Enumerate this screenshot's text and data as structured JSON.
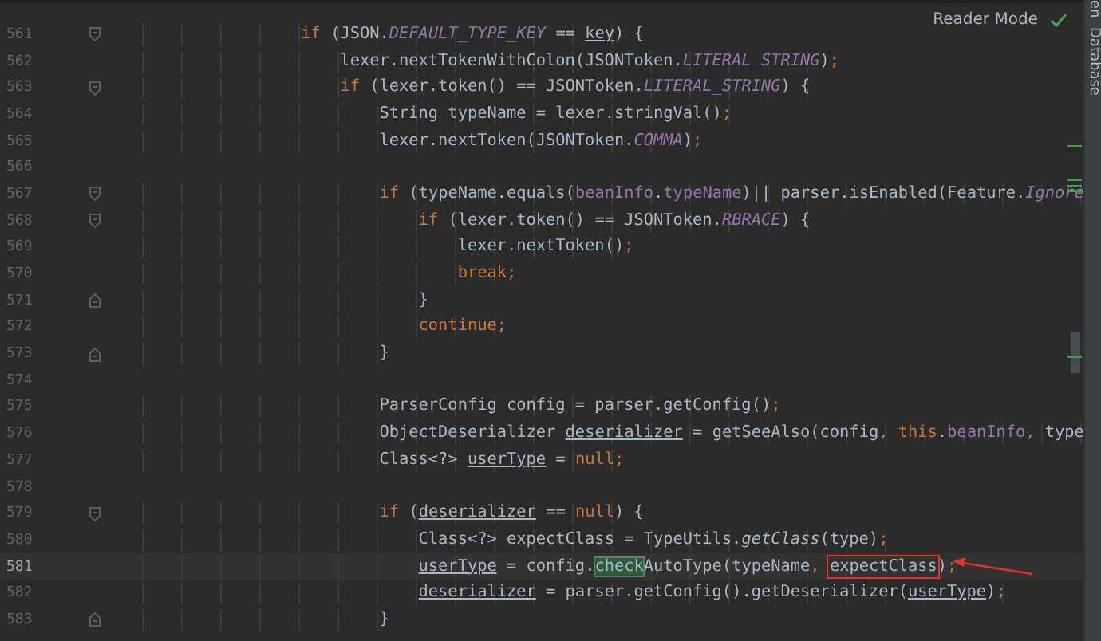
{
  "reader_mode": {
    "label": "Reader Mode"
  },
  "side_panel": {
    "tabs": [
      {
        "label": "en"
      },
      {
        "label": "Database"
      }
    ]
  },
  "lines": [
    {
      "number": "561",
      "fold_start": true,
      "fold_end": false,
      "current": false,
      "tokens": [
        {
          "kind": "keyword",
          "text": "                    if"
        },
        {
          "kind": "plain",
          "text": " (JSON."
        },
        {
          "kind": "constant",
          "text": "DEFAULT_TYPE_KEY"
        },
        {
          "kind": "plain",
          "text": " == "
        },
        {
          "kind": "var",
          "text": "key"
        },
        {
          "kind": "plain",
          "text": ") {"
        }
      ]
    },
    {
      "number": "562",
      "fold_start": false,
      "fold_end": false,
      "current": false,
      "tokens": [
        {
          "kind": "plain",
          "text": "                        lexer.nextTokenWithColon(JSONToken."
        },
        {
          "kind": "constant",
          "text": "LITERAL_STRING"
        },
        {
          "kind": "plain",
          "text": ")"
        },
        {
          "kind": "keyword",
          "text": ";"
        }
      ]
    },
    {
      "number": "563",
      "fold_start": true,
      "fold_end": false,
      "current": false,
      "tokens": [
        {
          "kind": "keyword",
          "text": "                        if"
        },
        {
          "kind": "plain",
          "text": " (lexer.token() == JSONToken."
        },
        {
          "kind": "constant",
          "text": "LITERAL_STRING"
        },
        {
          "kind": "plain",
          "text": ") {"
        }
      ]
    },
    {
      "number": "564",
      "fold_start": false,
      "fold_end": false,
      "current": false,
      "tokens": [
        {
          "kind": "plain",
          "text": "                            String typeName = lexer.stringVal()"
        },
        {
          "kind": "keyword",
          "text": ";"
        }
      ]
    },
    {
      "number": "565",
      "fold_start": false,
      "fold_end": false,
      "current": false,
      "tokens": [
        {
          "kind": "plain",
          "text": "                            lexer.nextToken(JSONToken."
        },
        {
          "kind": "constant",
          "text": "COMMA"
        },
        {
          "kind": "plain",
          "text": ")"
        },
        {
          "kind": "keyword",
          "text": ";"
        }
      ]
    },
    {
      "number": "566",
      "fold_start": false,
      "fold_end": false,
      "current": false
    },
    {
      "number": "567",
      "fold_start": true,
      "fold_end": false,
      "current": false,
      "tokens": [
        {
          "kind": "keyword",
          "text": "                            if"
        },
        {
          "kind": "plain",
          "text": " (typeName.equals("
        },
        {
          "kind": "field",
          "text": "beanInfo"
        },
        {
          "kind": "plain",
          "text": "."
        },
        {
          "kind": "field",
          "text": "typeName"
        },
        {
          "kind": "plain",
          "text": ")|| parser.isEnabled(Feature."
        },
        {
          "kind": "constant",
          "text": "Ignore"
        }
      ]
    },
    {
      "number": "568",
      "fold_start": true,
      "fold_end": false,
      "current": false,
      "tokens": [
        {
          "kind": "keyword",
          "text": "                                if"
        },
        {
          "kind": "plain",
          "text": " (lexer.token() == JSONToken."
        },
        {
          "kind": "constant",
          "text": "RBRACE"
        },
        {
          "kind": "plain",
          "text": ") {"
        }
      ]
    },
    {
      "number": "569",
      "fold_start": false,
      "fold_end": false,
      "current": false,
      "tokens": [
        {
          "kind": "plain",
          "text": "                                    lexer.nextToken()"
        },
        {
          "kind": "keyword",
          "text": ";"
        }
      ]
    },
    {
      "number": "570",
      "fold_start": false,
      "fold_end": false,
      "current": false,
      "tokens": [
        {
          "kind": "keyword",
          "text": "                                    break;"
        }
      ]
    },
    {
      "number": "571",
      "fold_start": false,
      "fold_end": true,
      "current": false,
      "tokens": [
        {
          "kind": "plain",
          "text": "                                }"
        }
      ]
    },
    {
      "number": "572",
      "fold_start": false,
      "fold_end": false,
      "current": false,
      "tokens": [
        {
          "kind": "keyword",
          "text": "                                continue;"
        }
      ]
    },
    {
      "number": "573",
      "fold_start": false,
      "fold_end": true,
      "current": false,
      "tokens": [
        {
          "kind": "plain",
          "text": "                            }"
        }
      ]
    },
    {
      "number": "574",
      "fold_start": false,
      "fold_end": false,
      "current": false
    },
    {
      "number": "575",
      "fold_start": false,
      "fold_end": false,
      "current": false,
      "tokens": [
        {
          "kind": "plain",
          "text": "                            ParserConfig config = parser.getConfig()"
        },
        {
          "kind": "keyword",
          "text": ";"
        }
      ]
    },
    {
      "number": "576",
      "fold_start": false,
      "fold_end": false,
      "current": false,
      "tokens": [
        {
          "kind": "plain",
          "text": "                            ObjectDeserializer "
        },
        {
          "kind": "var",
          "text": "deserializer"
        },
        {
          "kind": "plain",
          "text": " = getSeeAlso(config"
        },
        {
          "kind": "keyword",
          "text": ", this"
        },
        {
          "kind": "plain",
          "text": "."
        },
        {
          "kind": "field",
          "text": "beanInfo"
        },
        {
          "kind": "keyword",
          "text": ", "
        },
        {
          "kind": "plain",
          "text": "type"
        }
      ]
    },
    {
      "number": "577",
      "fold_start": false,
      "fold_end": false,
      "current": false,
      "tokens": [
        {
          "kind": "plain",
          "text": "                            Class<?> "
        },
        {
          "kind": "var",
          "text": "userType"
        },
        {
          "kind": "plain",
          "text": " = "
        },
        {
          "kind": "keyword",
          "text": "null;"
        }
      ]
    },
    {
      "number": "578",
      "fold_start": false,
      "fold_end": false,
      "current": false
    },
    {
      "number": "579",
      "fold_start": true,
      "fold_end": false,
      "current": false,
      "tokens": [
        {
          "kind": "keyword",
          "text": "                            if"
        },
        {
          "kind": "plain",
          "text": " ("
        },
        {
          "kind": "var",
          "text": "deserializer"
        },
        {
          "kind": "plain",
          "text": " == "
        },
        {
          "kind": "keyword",
          "text": "null"
        },
        {
          "kind": "plain",
          "text": ") {"
        }
      ]
    },
    {
      "number": "580",
      "fold_start": false,
      "fold_end": false,
      "current": false,
      "tokens": [
        {
          "kind": "plain",
          "text": "                                Class<?> expectClass = TypeUtils."
        },
        {
          "kind": "italic",
          "text": "getClass"
        },
        {
          "kind": "plain",
          "text": "(type)"
        },
        {
          "kind": "keyword",
          "text": ";"
        }
      ]
    },
    {
      "number": "581",
      "fold_start": false,
      "fold_end": false,
      "current": true,
      "tokens": [
        {
          "kind": "var",
          "text": "                                userType"
        },
        {
          "kind": "plain",
          "text": " = config."
        },
        {
          "kind": "match",
          "text": "check"
        },
        {
          "kind": "plain",
          "text": "AutoType(typeName"
        },
        {
          "kind": "keyword",
          "text": ", "
        },
        {
          "kind": "boxed",
          "text": "expectClass"
        },
        {
          "kind": "plain",
          "text": ")"
        },
        {
          "kind": "keyword",
          "text": ";"
        }
      ]
    },
    {
      "number": "582",
      "fold_start": false,
      "fold_end": false,
      "current": false,
      "tokens": [
        {
          "kind": "var",
          "text": "                                deserializer"
        },
        {
          "kind": "plain",
          "text": " = parser.getConfig().getDeserializer("
        },
        {
          "kind": "var",
          "text": "userType"
        },
        {
          "kind": "plain",
          "text": ")"
        },
        {
          "kind": "keyword",
          "text": ";"
        }
      ]
    },
    {
      "number": "583",
      "fold_start": false,
      "fold_end": true,
      "current": false,
      "tokens": [
        {
          "kind": "plain",
          "text": "                            }"
        }
      ]
    }
  ]
}
